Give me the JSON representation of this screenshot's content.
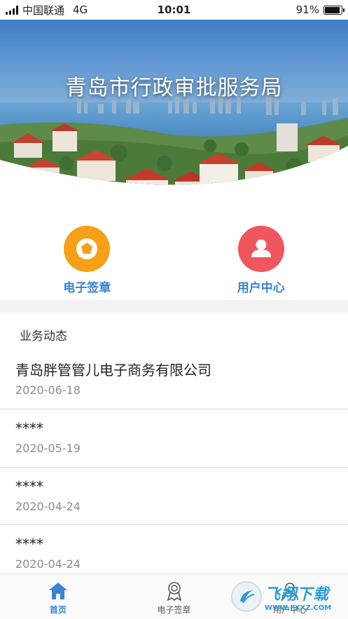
{
  "status_bar": {
    "carrier": "中国联通",
    "network": "4G",
    "time": "10:01",
    "battery_text": "91%",
    "battery_level": 0.91
  },
  "hero": {
    "title": "青岛市行政审批服务局"
  },
  "actions": [
    {
      "label": "电子签章",
      "icon": "seal-icon",
      "color": "#f6a018"
    },
    {
      "label": "用户中心",
      "icon": "user-icon",
      "color": "#f0565e"
    }
  ],
  "news": {
    "section_title": "业务动态",
    "items": [
      {
        "title": "青岛胖管管儿电子商务有限公司",
        "date": "2020-06-18"
      },
      {
        "title": "****",
        "date": "2020-05-19"
      },
      {
        "title": "****",
        "date": "2020-04-24"
      },
      {
        "title": "****",
        "date": "2020-04-24"
      }
    ]
  },
  "tab_bar": {
    "tabs": [
      {
        "label": "首页",
        "icon": "home-icon",
        "active": true
      },
      {
        "label": "电子签章",
        "icon": "badge-icon",
        "active": false
      },
      {
        "label": "用户中心",
        "icon": "user-icon",
        "active": false
      }
    ]
  },
  "watermark": {
    "main": "飞翔下载",
    "url": "WWW.FXXZ.COM"
  },
  "colors": {
    "accent": "#3b82d6",
    "seal": "#f6a018",
    "user": "#f0565e"
  }
}
